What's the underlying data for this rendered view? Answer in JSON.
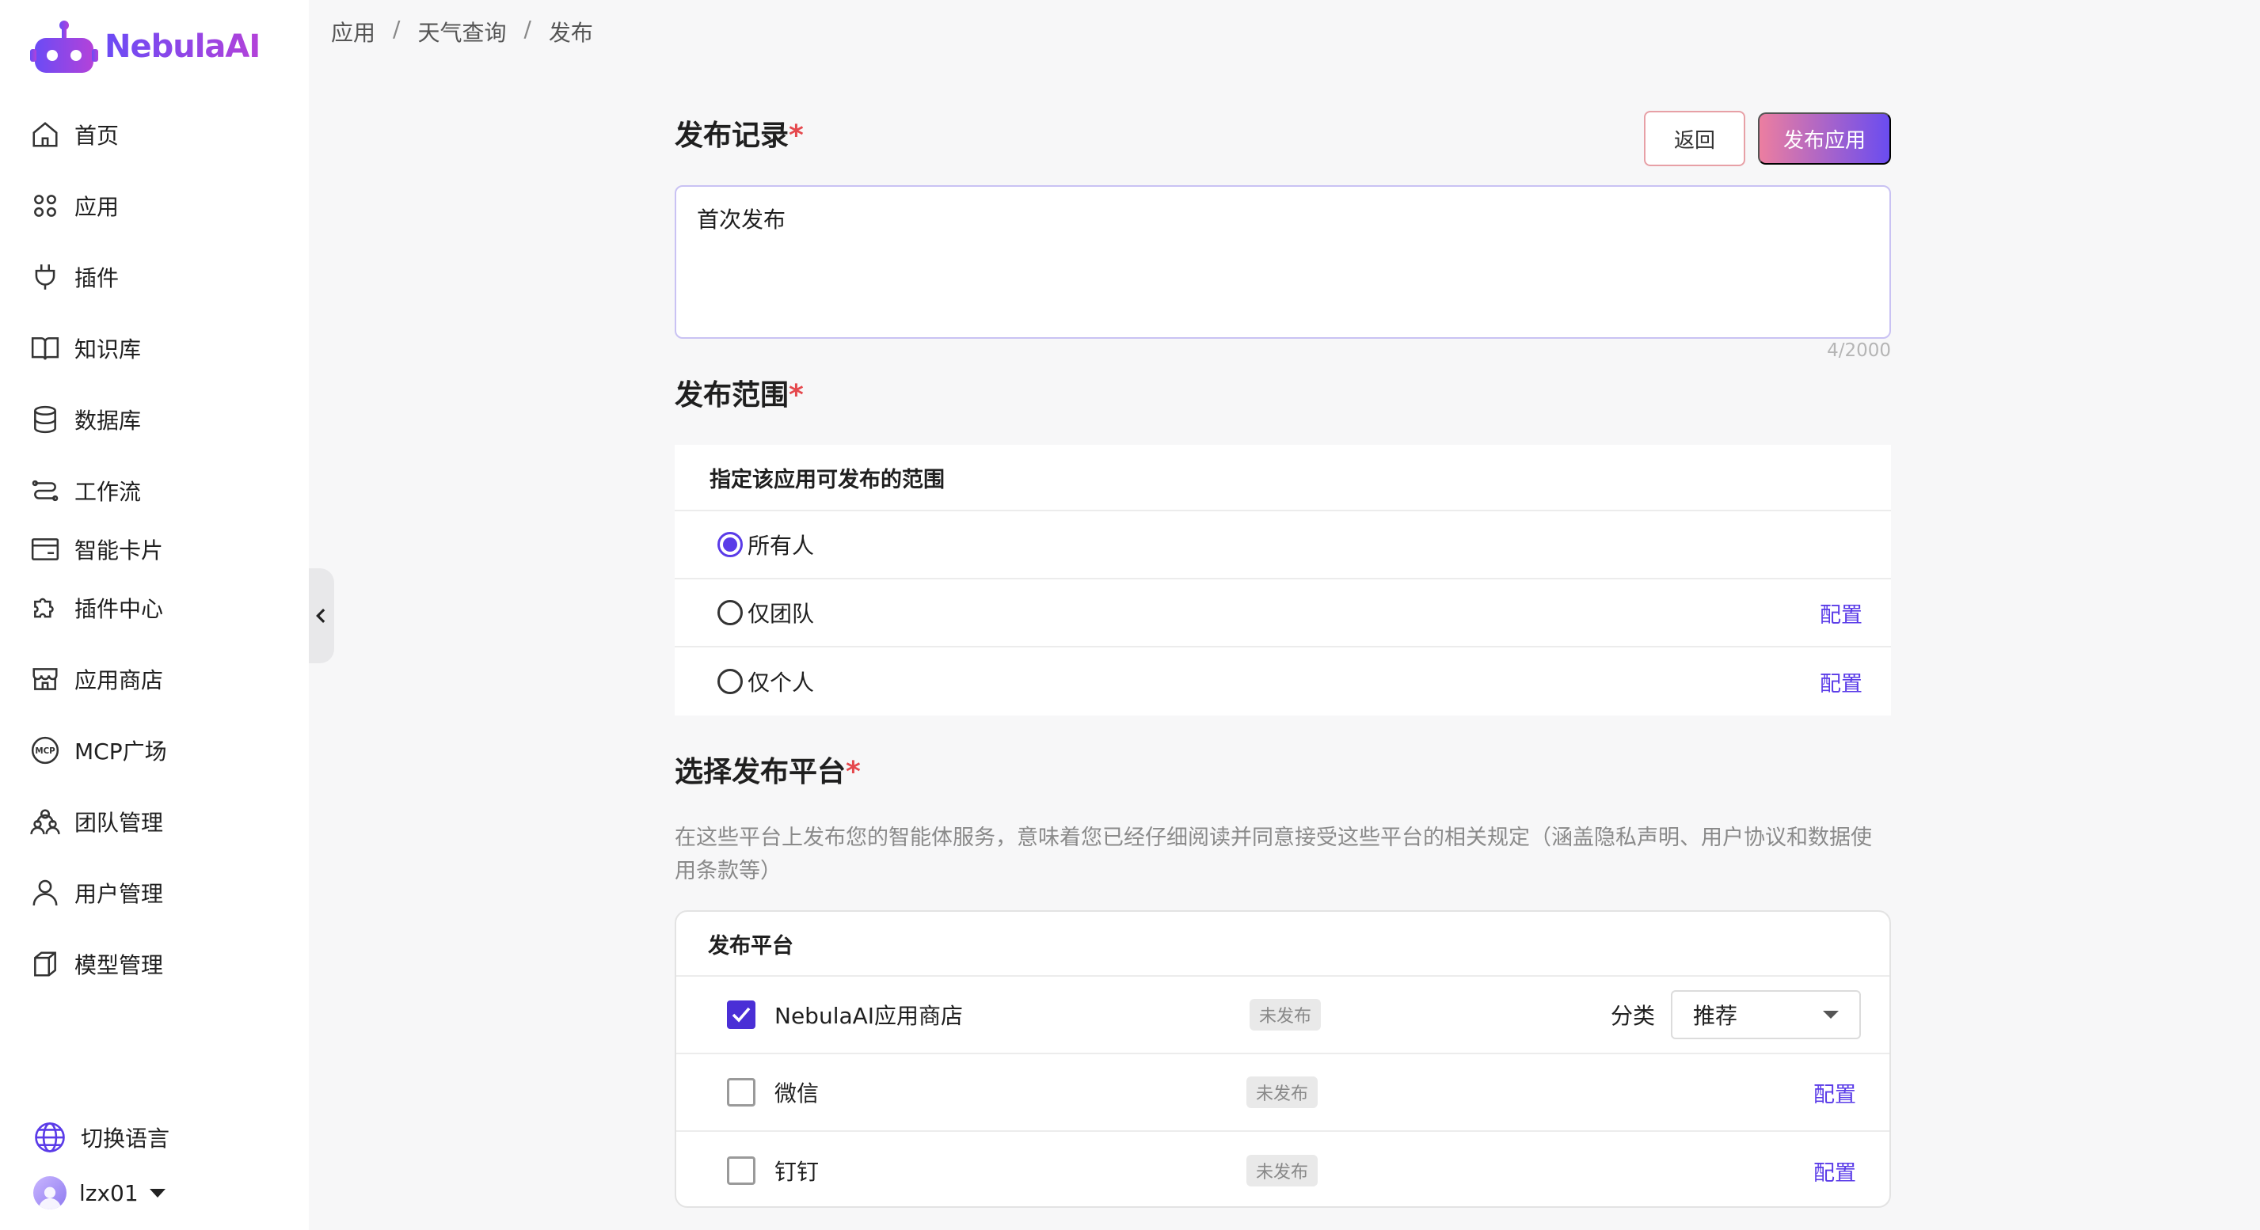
{
  "app": {
    "name": "NebulaAI"
  },
  "colors": {
    "accent": "#5a3be8",
    "required": "#e5484d",
    "gradient_start": "#ec7ea0",
    "gradient_end": "#6a4cf0"
  },
  "sidebar": {
    "items": [
      {
        "label": "首页",
        "icon": "home-icon"
      },
      {
        "label": "应用",
        "icon": "apps-grid-icon"
      },
      {
        "label": "插件",
        "icon": "plug-icon"
      },
      {
        "label": "知识库",
        "icon": "book-icon"
      },
      {
        "label": "数据库",
        "icon": "database-icon"
      },
      {
        "label": "工作流",
        "icon": "workflow-icon"
      },
      {
        "label": "智能卡片",
        "icon": "card-icon"
      },
      {
        "label": "插件中心",
        "icon": "puzzle-icon"
      },
      {
        "label": "应用商店",
        "icon": "store-icon"
      },
      {
        "label": "MCP广场",
        "icon": "mcp-icon"
      },
      {
        "label": "团队管理",
        "icon": "team-icon"
      },
      {
        "label": "用户管理",
        "icon": "user-icon"
      },
      {
        "label": "模型管理",
        "icon": "cube-icon"
      }
    ],
    "language": "切换语言",
    "user": "lzx01"
  },
  "breadcrumb": {
    "level1": "应用",
    "level2": "天气查询",
    "level3": "发布",
    "separator": "/"
  },
  "record": {
    "title": "发布记录",
    "required_mark": "*",
    "value": "首次发布",
    "counter": "4/2000",
    "back_label": "返回",
    "publish_label": "发布应用"
  },
  "scope": {
    "title": "发布范围",
    "required_mark": "*",
    "header": "指定该应用可发布的范围",
    "options": [
      {
        "label": "所有人",
        "selected": true,
        "config": ""
      },
      {
        "label": "仅团队",
        "selected": false,
        "config": "配置"
      },
      {
        "label": "仅个人",
        "selected": false,
        "config": "配置"
      }
    ]
  },
  "platform": {
    "title": "选择发布平台",
    "required_mark": "*",
    "description": "在这些平台上发布您的智能体服务，意味着您已经仔细阅读并同意接受这些平台的相关规定（涵盖隐私声明、用户协议和数据使用条款等）",
    "header": "发布平台",
    "category_label": "分类",
    "category_value": "推荐",
    "rows": [
      {
        "name": "NebulaAI应用商店",
        "checked": true,
        "status": "未发布",
        "config": ""
      },
      {
        "name": "微信",
        "checked": false,
        "status": "未发布",
        "config": "配置"
      },
      {
        "name": "钉钉",
        "checked": false,
        "status": "未发布",
        "config": "配置"
      }
    ]
  }
}
